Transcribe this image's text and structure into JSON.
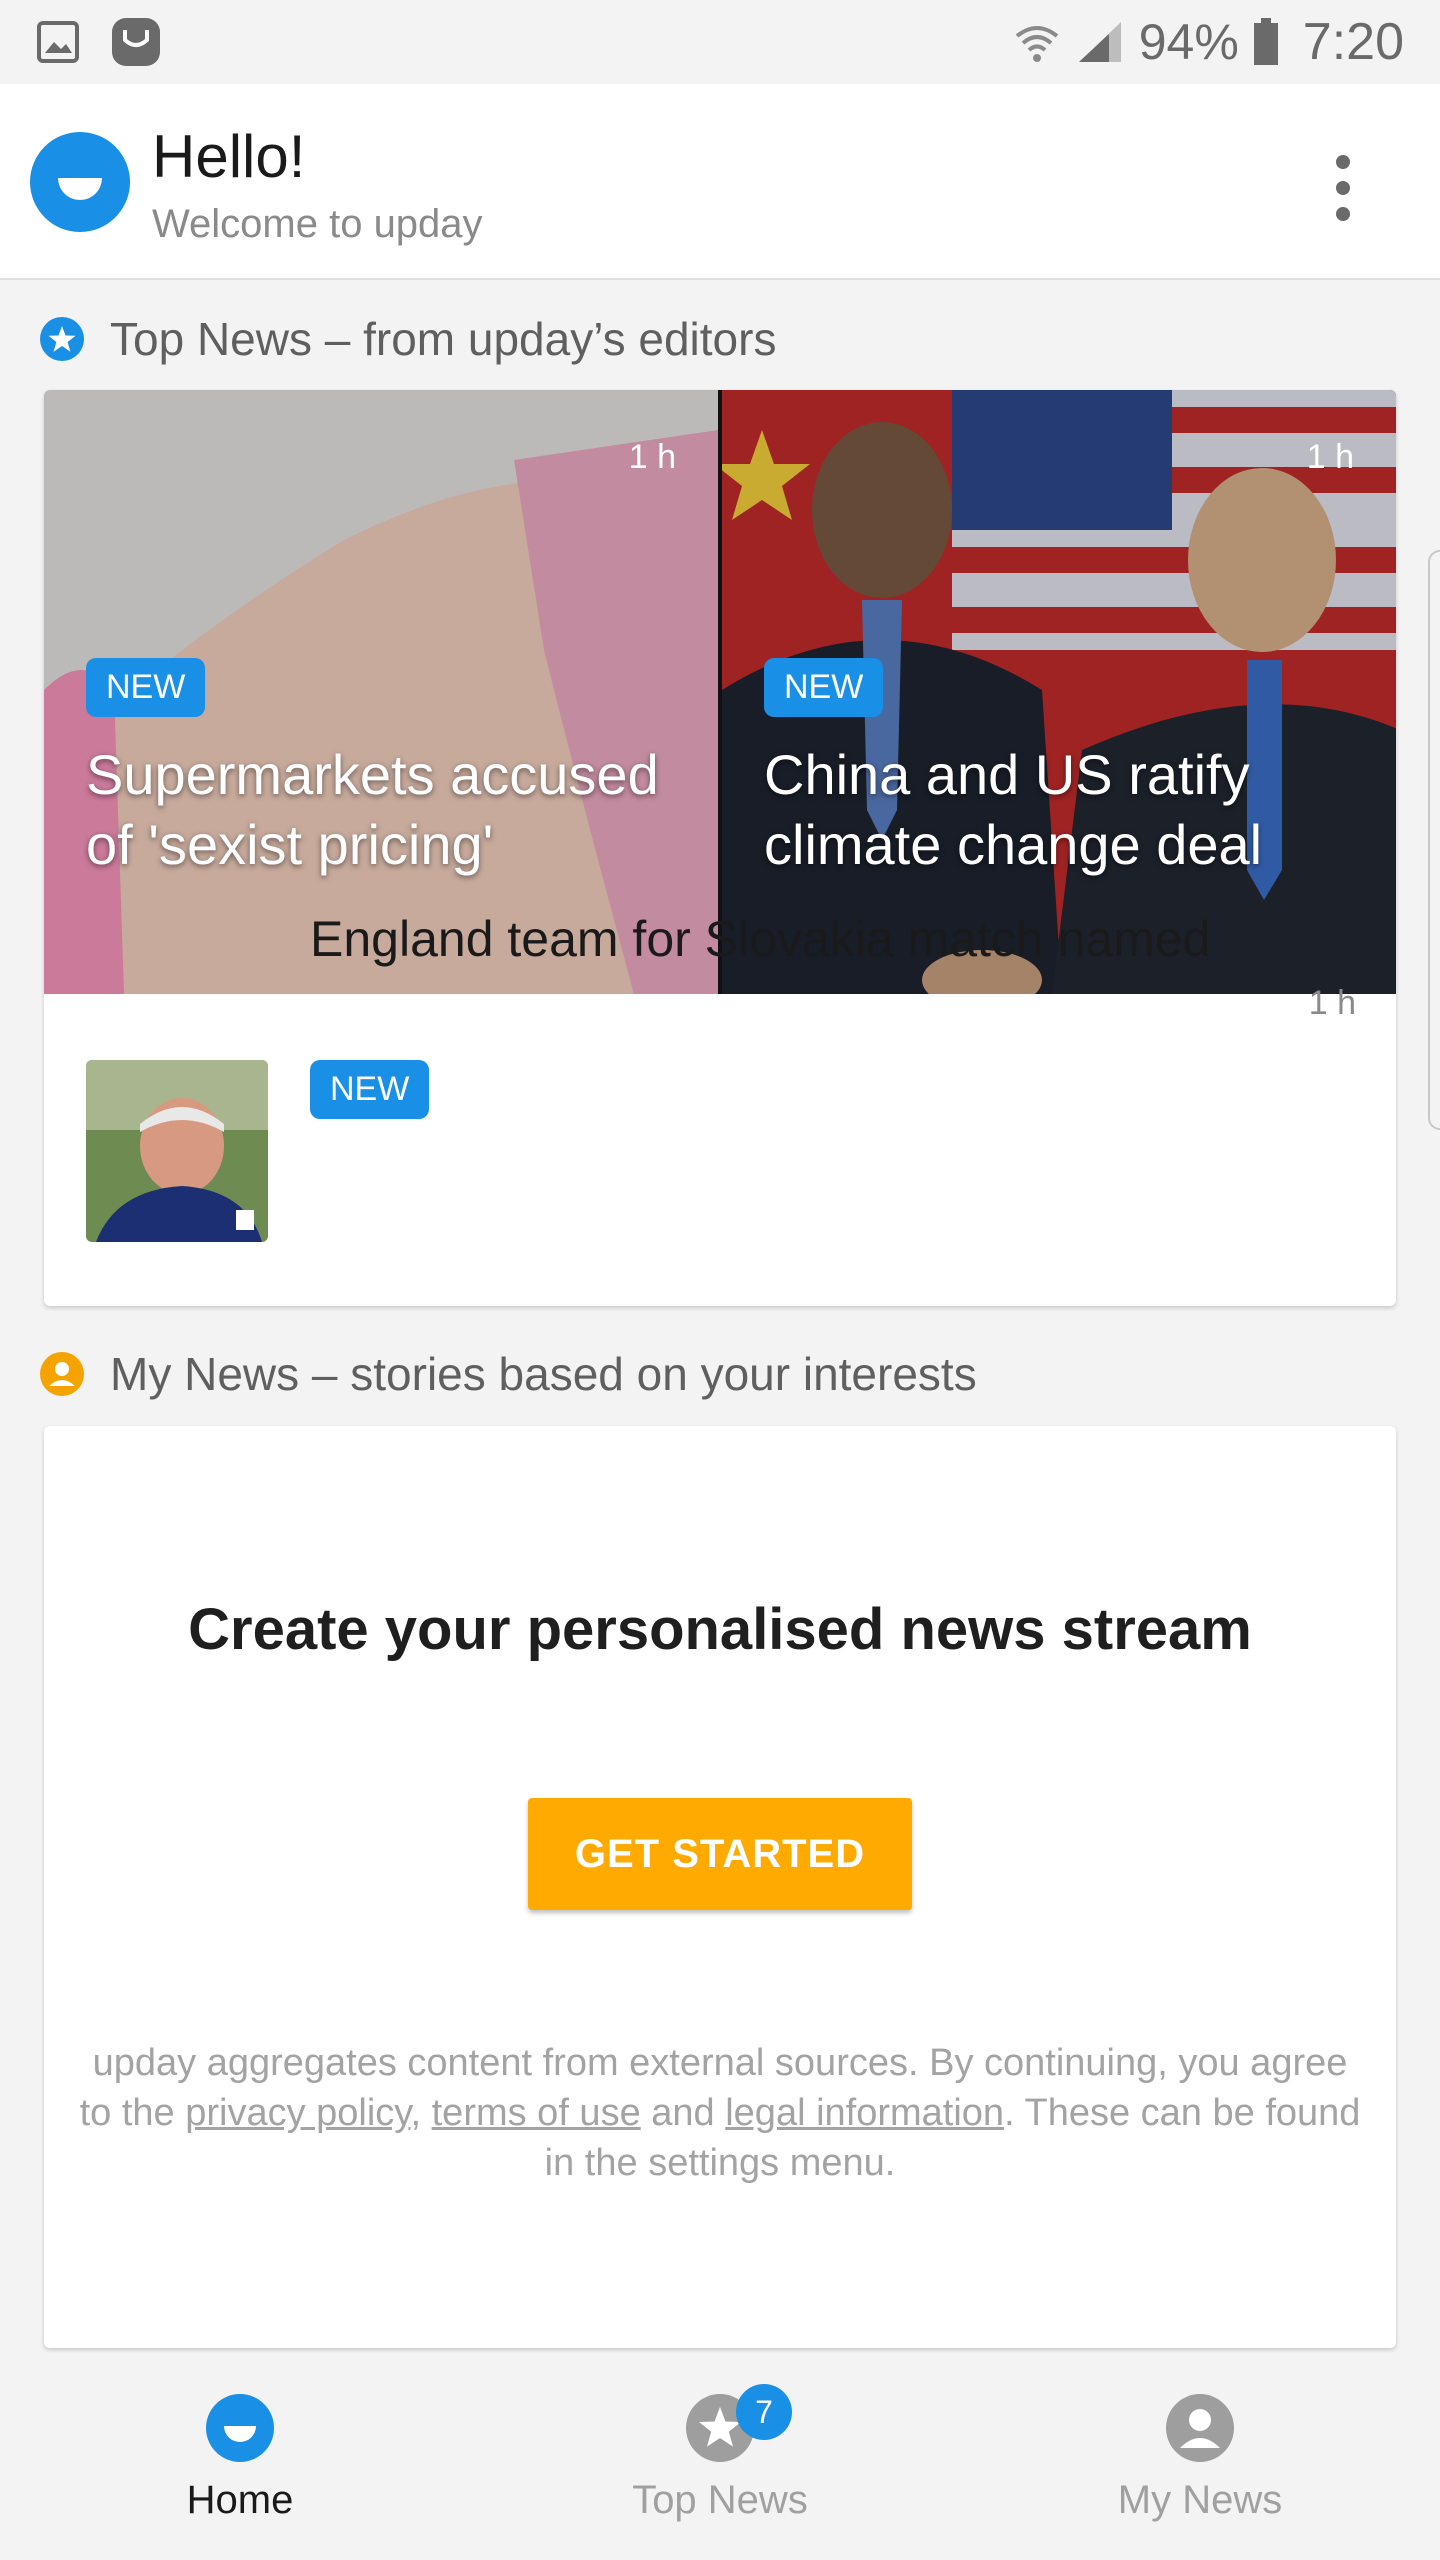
{
  "status_bar": {
    "battery": "94%",
    "time": "7:20"
  },
  "header": {
    "title": "Hello!",
    "subtitle": "Welcome to upday"
  },
  "top_news": {
    "section_title": "Top News – from upday’s editors",
    "tiles": [
      {
        "time": "1 h",
        "badge": "NEW",
        "headline": "Supermarkets accused of 'sexist pricing'"
      },
      {
        "time": "1 h",
        "badge": "NEW",
        "headline": "China and US ratify climate change deal"
      }
    ],
    "article": {
      "badge": "NEW",
      "title": "England team for Slovakia match named",
      "time": "1 h"
    }
  },
  "my_news": {
    "section_title": "My News – stories based on your interests",
    "create_title": "Create your personalised news stream",
    "button_label": "GET STARTED",
    "disclaimer": {
      "part1": "upday aggregates content from external sources. By continuing, you agree to the ",
      "privacy_link": "privacy policy",
      "sep": ", ",
      "terms_link": "terms of use",
      "and": " and ",
      "legal_link": "legal information",
      "part2": ". These can be found in the settings menu."
    }
  },
  "bottom_nav": {
    "items": [
      {
        "label": "Home"
      },
      {
        "label": "Top News",
        "badge": "7"
      },
      {
        "label": "My News"
      }
    ]
  },
  "colors": {
    "accent_blue": "#1a8fe6",
    "accent_orange": "#ffaa00"
  }
}
